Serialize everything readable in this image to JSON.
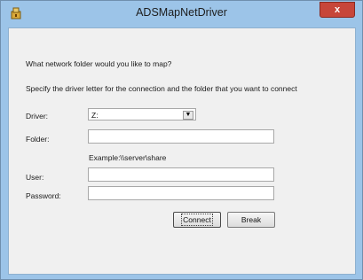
{
  "window": {
    "title": "ADSMapNetDriver",
    "close_glyph": "x",
    "icon": "app-icon"
  },
  "form": {
    "prompt": "What network folder would you like to map?",
    "instructions": "Specify the driver letter for the connection and the folder that you want to connect",
    "driver_label": "Driver:",
    "driver_value": "Z:",
    "folder_label": "Folder:",
    "folder_value": "",
    "example": "Example:\\\\server\\share",
    "user_label": "User:",
    "user_value": "",
    "password_label": "Password:",
    "password_value": ""
  },
  "buttons": {
    "connect": "Connect",
    "break": "Break"
  }
}
